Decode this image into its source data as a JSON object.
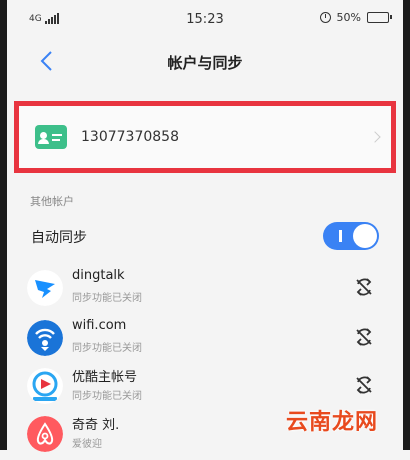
{
  "status_bar": {
    "network": "4G",
    "time": "15:23",
    "battery_percent": "50%",
    "battery_level": 0.5
  },
  "nav": {
    "title": "帐户与同步"
  },
  "account": {
    "phone": "13077370858"
  },
  "section": {
    "other_accounts_label": "其他帐户"
  },
  "auto_sync": {
    "label": "自动同步",
    "enabled": true
  },
  "accounts": [
    {
      "name": "dingtalk",
      "status": "同步功能已关闭",
      "icon": "dingtalk-icon",
      "color": "#1890ff"
    },
    {
      "name": "wifi.com",
      "status": "同步功能已关闭",
      "icon": "wifi-icon",
      "color": "#1a74d8"
    },
    {
      "name": "优酷主帐号",
      "status": "同步功能已关闭",
      "icon": "youku-icon",
      "color": "#2aa6f2"
    },
    {
      "name": "奇奇 刘.",
      "status": "爱彼迎",
      "icon": "airbnb-icon",
      "color": "#ff5a5f"
    }
  ],
  "watermark": "云南龙网",
  "colors": {
    "highlight_border": "#e8343f",
    "toggle_on": "#3a82f4",
    "contact_icon": "#3dbf8a"
  }
}
